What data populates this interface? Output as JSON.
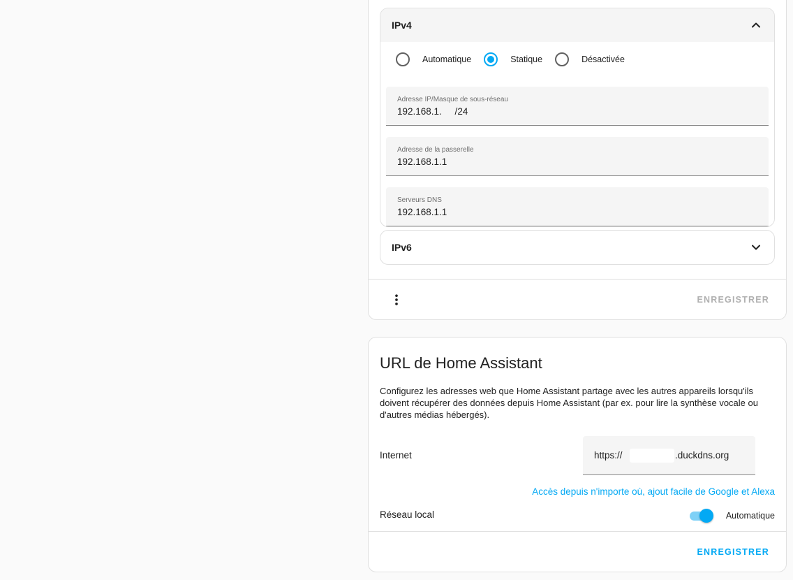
{
  "network": {
    "ipv4": {
      "title": "IPv4",
      "radios": [
        {
          "label": "Automatique",
          "checked": false
        },
        {
          "label": "Statique",
          "checked": true
        },
        {
          "label": "Désactivée",
          "checked": false
        }
      ],
      "fields": [
        {
          "label": "Adresse IP/Masque de sous-réseau",
          "value": "192.168.1.     /24"
        },
        {
          "label": "Adresse de la passerelle",
          "value": "192.168.1.1"
        },
        {
          "label": "Serveurs DNS",
          "value": "192.168.1.1"
        }
      ]
    },
    "ipv6": {
      "title": "IPv6"
    },
    "save_label": "ENREGISTRER"
  },
  "url": {
    "title": "URL de Home Assistant",
    "description": "Configurez les adresses web que Home Assistant partage avec les autres appareils lorsqu'ils doivent récupérer des données depuis Home Assistant (par ex. pour lire la synthèse vocale ou d'autres médias hébergés).",
    "internet_label": "Internet",
    "internet_prefix": "https://",
    "internet_suffix": ".duckdns.org",
    "cloud_link": "Accès depuis n'importe où, ajout facile de Google et Alexa",
    "local_label": "Réseau local",
    "toggle_label": "Automatique",
    "toggle_on": true,
    "save_label": "ENREGISTRER"
  },
  "colors": {
    "accent": "#03a9f4",
    "disabled": "#b0b0b0"
  }
}
